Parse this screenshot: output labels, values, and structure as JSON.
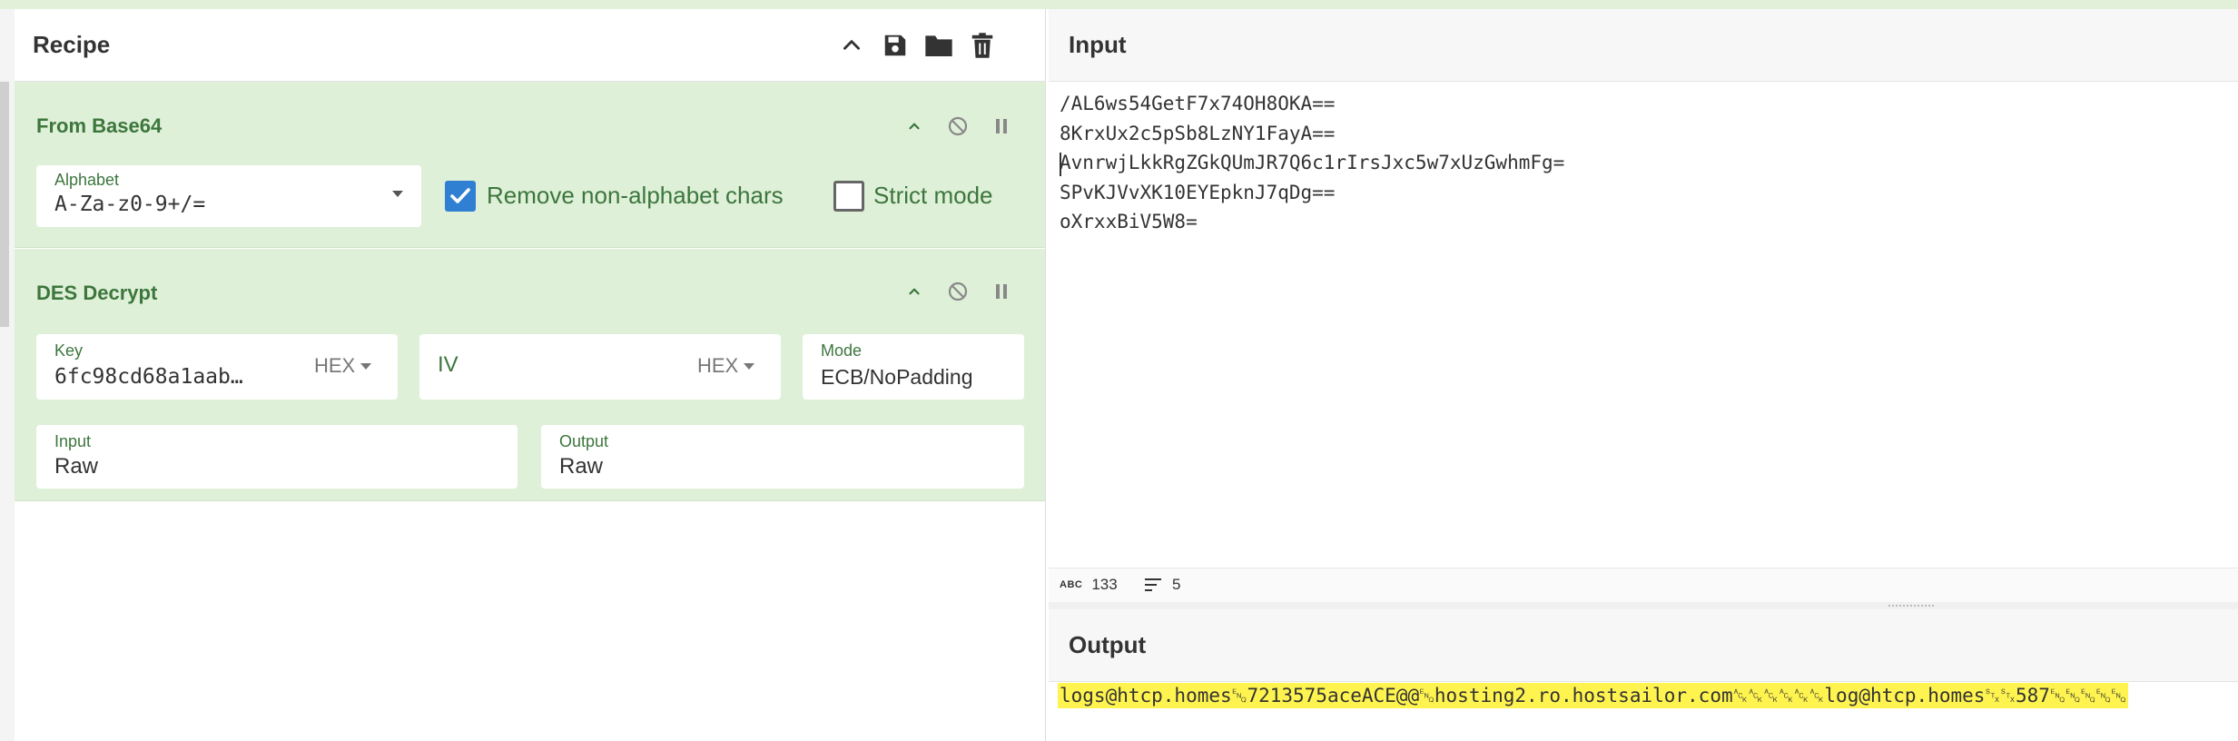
{
  "colors": {
    "accent_green": "#3c763d",
    "op_background": "#dff0d8",
    "checkbox_blue": "#2f7fd3",
    "output_highlight": "#fff44f"
  },
  "recipe": {
    "title": "Recipe",
    "icons": [
      "chevron-up-icon",
      "save-icon",
      "folder-icon",
      "trash-icon"
    ],
    "operations": [
      {
        "title": "From Base64",
        "alphabet_label": "Alphabet",
        "alphabet_value": "A-Za-z0-9+/=",
        "remove_nonalpha_label": "Remove non-alphabet chars",
        "remove_nonalpha_checked": true,
        "strict_mode_label": "Strict mode",
        "strict_mode_checked": false
      },
      {
        "title": "DES Decrypt",
        "key_label": "Key",
        "key_value": "6fc98cd68a1aab…",
        "key_format": "HEX",
        "iv_label": "IV",
        "iv_format": "HEX",
        "mode_label": "Mode",
        "mode_value": "ECB/NoPadding",
        "input_label": "Input",
        "input_value": "Raw",
        "output_label": "Output",
        "output_value": "Raw"
      }
    ]
  },
  "input": {
    "title": "Input",
    "lines": [
      "/AL6ws54GetF7x74OH8OKA==",
      "8KrxUx2c5pSb8LzNY1FayA==",
      "AvnrwjLkkRgZGkQUmJR7Q6c1rIrsJxc5w7xUzGwhmFg=",
      "SPvKJVvXK10EYEpknJ7qDg==",
      "oXrxxBiV5W8="
    ],
    "stats": {
      "char_count_label": "ABC",
      "char_count": "133",
      "line_count": "5"
    }
  },
  "output": {
    "title": "Output",
    "text": "logs@htcp.homes␅7213575aceACE@@␅hosting2.ro.hostsailor.com␆␆␆␆␆␆log@htcp.homes␂␂587␅␅␅␅␅"
  }
}
